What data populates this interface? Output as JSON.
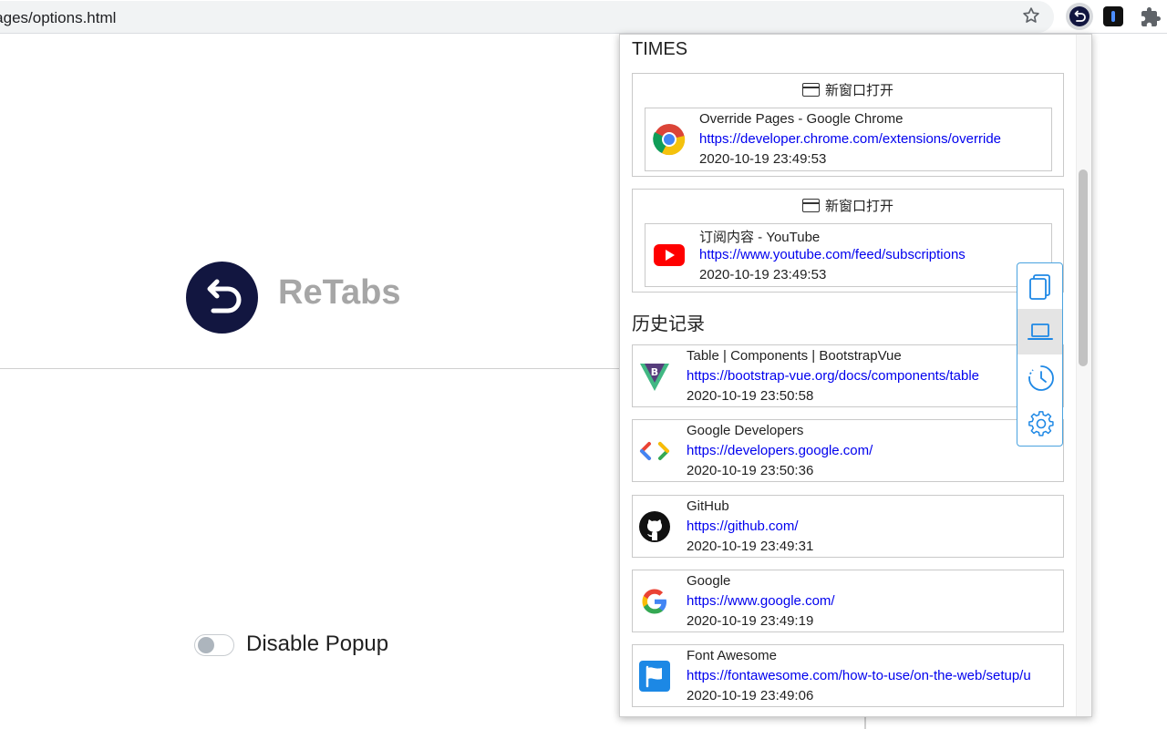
{
  "browser": {
    "url": "/pages/options.html"
  },
  "options": {
    "logo_text": "ReTabs",
    "toggle_label": "Disable Popup",
    "toggle_on": false
  },
  "popup": {
    "sessions_title": "TIMES",
    "sessions": [
      {
        "open_label": "新窗口打开",
        "tab": {
          "title": "Override Pages - Google Chrome",
          "url": "https://developer.chrome.com/extensions/override",
          "time": "2020-10-19 23:49:53",
          "favicon": "chrome-icon"
        }
      },
      {
        "open_label": "新窗口打开",
        "tab": {
          "title": "订阅内容 - YouTube",
          "url": "https://www.youtube.com/feed/subscriptions",
          "time": "2020-10-19 23:49:53",
          "favicon": "youtube-icon"
        }
      }
    ],
    "history_title": "历史记录",
    "history": [
      {
        "title": "Table | Components | BootstrapVue",
        "url": "https://bootstrap-vue.org/docs/components/table",
        "time": "2020-10-19 23:50:58",
        "favicon": "bootstrapvue-icon"
      },
      {
        "title": "Google Developers",
        "url": "https://developers.google.com/",
        "time": "2020-10-19 23:50:36",
        "favicon": "google-developers-icon"
      },
      {
        "title": "GitHub",
        "url": "https://github.com/",
        "time": "2020-10-19 23:49:31",
        "favicon": "github-icon"
      },
      {
        "title": "Google",
        "url": "https://www.google.com/",
        "time": "2020-10-19 23:49:19",
        "favicon": "google-icon"
      },
      {
        "title": "Font Awesome",
        "url": "https://fontawesome.com/how-to-use/on-the-web/setup/u",
        "time": "2020-10-19 23:49:06",
        "favicon": "fontawesome-icon"
      }
    ],
    "nav": [
      {
        "icon": "copy-icon",
        "active": false
      },
      {
        "icon": "laptop-icon",
        "active": true
      },
      {
        "icon": "clock-icon",
        "active": false
      },
      {
        "icon": "gear-icon",
        "active": false
      }
    ]
  },
  "colors": {
    "link": "#0000ee",
    "accent": "#1e88e5",
    "logo_bg": "#121640",
    "logo_text": "#a6a6a6"
  }
}
